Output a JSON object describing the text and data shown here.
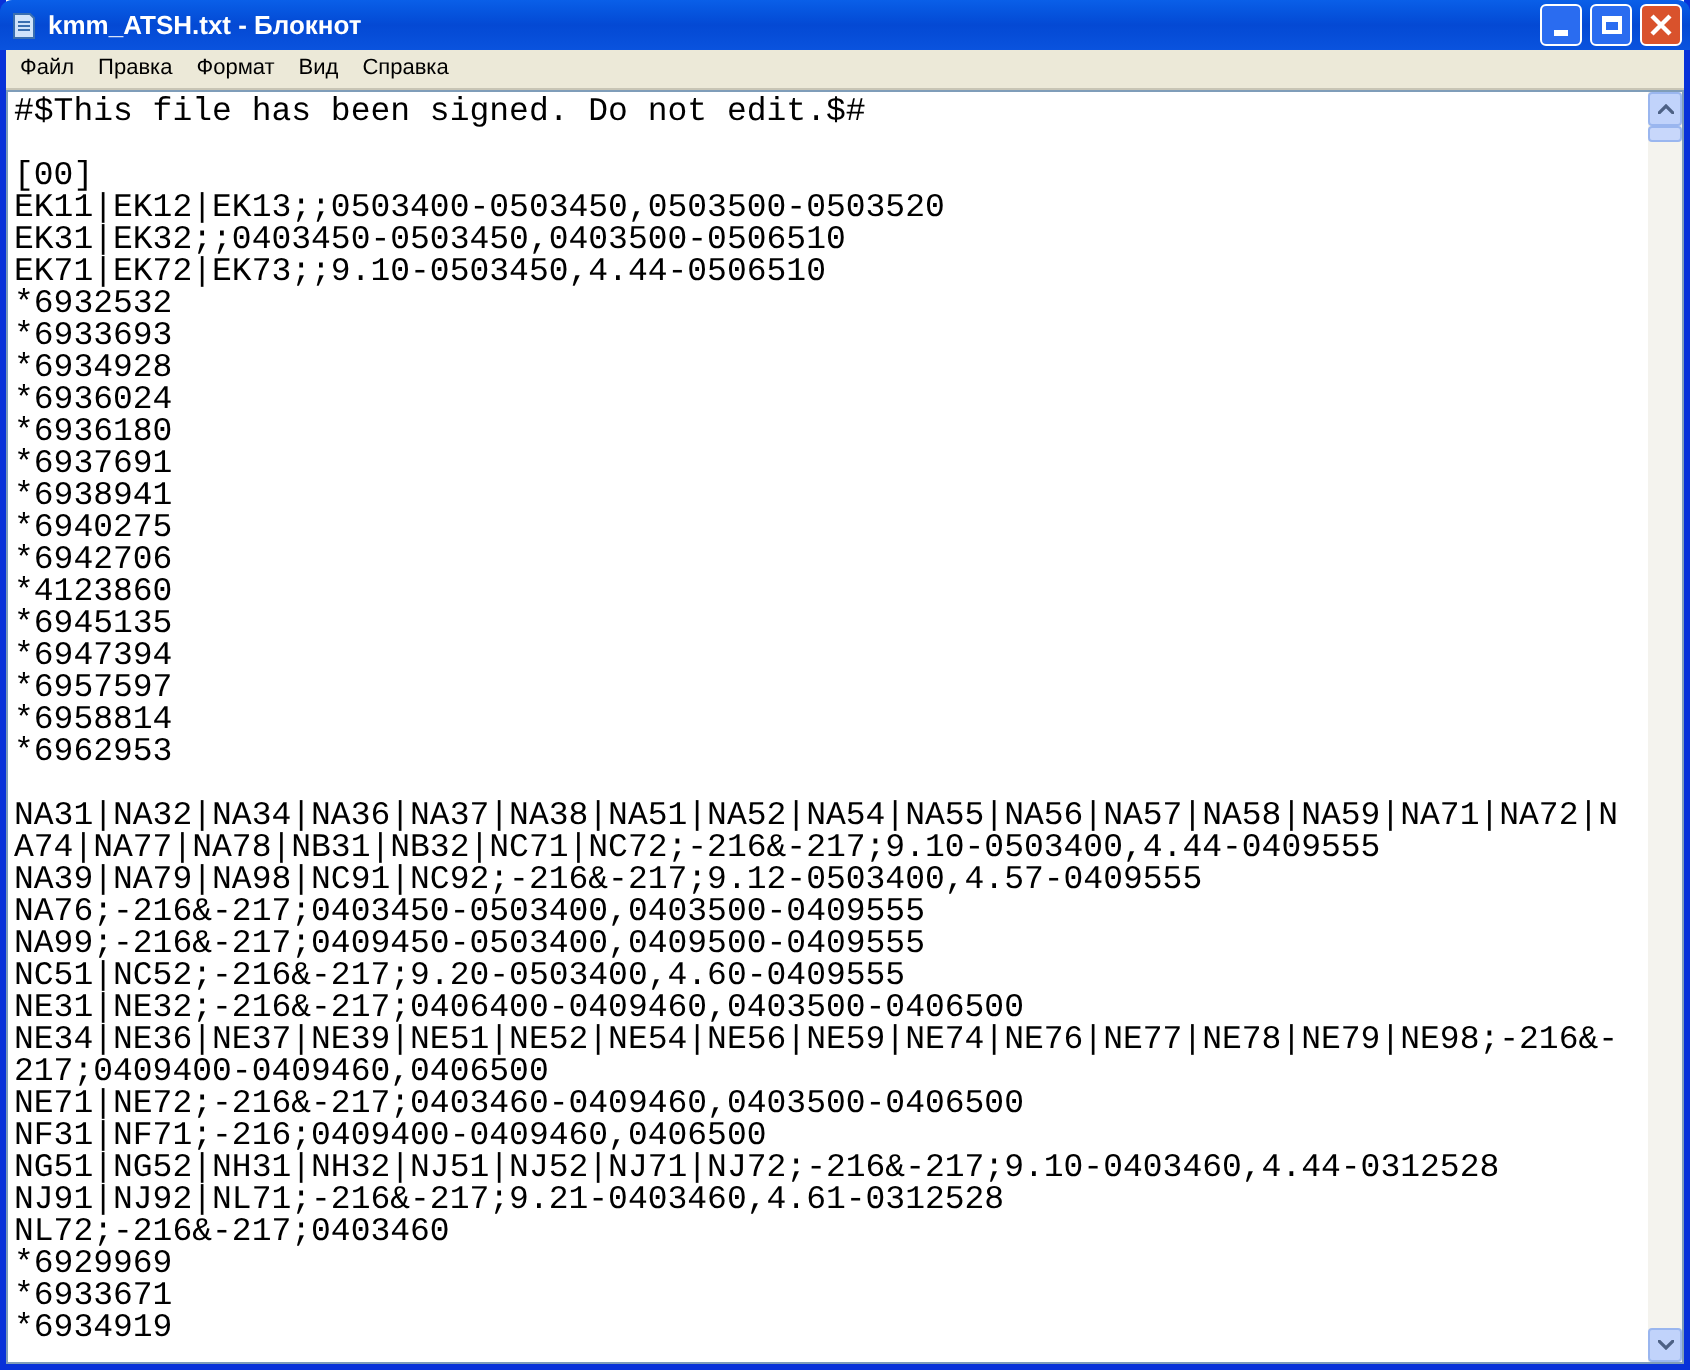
{
  "window": {
    "title": "kmm_ATSH.txt - Блокнот"
  },
  "menu": [
    "Файл",
    "Правка",
    "Формат",
    "Вид",
    "Справка"
  ],
  "blocks": [
    [
      "#$This file has been signed. Do not edit.$#"
    ],
    [
      "[00]",
      "EK11|EK12|EK13;;0503400-0503450,0503500-0503520",
      "EK31|EK32;;0403450-0503450,0403500-0506510",
      "EK71|EK72|EK73;;9.10-0503450,4.44-0506510",
      "*6932532",
      "*6933693",
      "*6934928",
      "*6936024",
      "*6936180",
      "*6937691",
      "*6938941",
      "*6940275",
      "*6942706",
      "*4123860",
      "*6945135",
      "*6947394",
      "*6957597",
      "*6958814",
      "*6962953"
    ],
    [
      "NA31|NA32|NA34|NA36|NA37|NA38|NA51|NA52|NA54|NA55|NA56|NA57|NA58|NA59|NA71|NA72|N",
      "A74|NA77|NA78|NB31|NB32|NC71|NC72;-216&-217;9.10-0503400,4.44-0409555",
      "NA39|NA79|NA98|NC91|NC92;-216&-217;9.12-0503400,4.57-0409555",
      "NA76;-216&-217;0403450-0503400,0403500-0409555",
      "NA99;-216&-217;0409450-0503400,0409500-0409555",
      "NC51|NC52;-216&-217;9.20-0503400,4.60-0409555",
      "NE31|NE32;-216&-217;0406400-0409460,0403500-0406500",
      "NE34|NE36|NE37|NE39|NE51|NE52|NE54|NE56|NE59|NE74|NE76|NE77|NE78|NE79|NE98;-216&-",
      "217;0409400-0409460,0406500",
      "NE71|NE72;-216&-217;0403460-0409460,0403500-0406500",
      "NF31|NF71;-216;0409400-0409460,0406500",
      "NG51|NG52|NH31|NH32|NJ51|NJ52|NJ71|NJ72;-216&-217;9.10-0403460,4.44-0312528",
      "NJ91|NJ92|NL71;-216&-217;9.21-0403460,4.61-0312528",
      "NL72;-216&-217;0403460",
      "*6929969",
      "*6933671",
      "*6934919"
    ]
  ]
}
